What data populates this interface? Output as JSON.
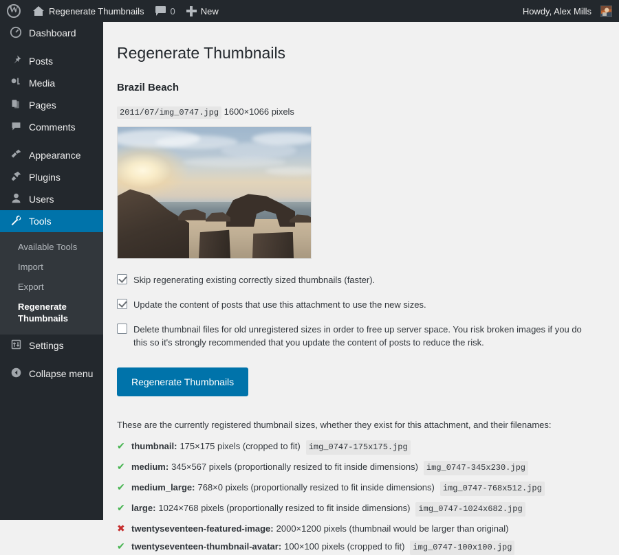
{
  "adminbar": {
    "wp_logo": "wordpress-logo",
    "site_name": "Regenerate Thumbnails",
    "comments_count": "0",
    "new_label": "New",
    "howdy": "Howdy, Alex Mills"
  },
  "sidebar": {
    "items": [
      {
        "label": "Dashboard",
        "icon": "dashboard-icon",
        "current": false
      },
      {
        "label": "Posts",
        "icon": "pin-icon",
        "current": false
      },
      {
        "label": "Media",
        "icon": "media-icon",
        "current": false
      },
      {
        "label": "Pages",
        "icon": "pages-icon",
        "current": false
      },
      {
        "label": "Comments",
        "icon": "comments-icon",
        "current": false
      },
      {
        "label": "Appearance",
        "icon": "paintbrush-icon",
        "current": false
      },
      {
        "label": "Plugins",
        "icon": "plugins-icon",
        "current": false
      },
      {
        "label": "Users",
        "icon": "users-icon",
        "current": false
      },
      {
        "label": "Tools",
        "icon": "wrench-icon",
        "current": true
      },
      {
        "label": "Settings",
        "icon": "settings-sliders-icon",
        "current": false
      },
      {
        "label": "Collapse menu",
        "icon": "collapse-arrow-icon",
        "current": false
      }
    ],
    "submenu": [
      {
        "label": "Available Tools",
        "current": false
      },
      {
        "label": "Import",
        "current": false
      },
      {
        "label": "Export",
        "current": false
      },
      {
        "label": "Regenerate Thumbnails",
        "current": true
      }
    ]
  },
  "main": {
    "page_title": "Regenerate Thumbnails",
    "attachment_title": "Brazil Beach",
    "file_path": "2011/07/img_0747.jpg",
    "dimensions": "1600×1066 pixels",
    "thumbnail_alt": "Brazil Beach sunset with rock formations",
    "options": [
      {
        "label": "Skip regenerating existing correctly sized thumbnails (faster).",
        "checked": true
      },
      {
        "label": "Update the content of posts that use this attachment to use the new sizes.",
        "checked": true
      },
      {
        "label": "Delete thumbnail files for old unregistered sizes in order to free up server space. You risk broken images if you do this so it's strongly recommended that you update the content of posts to reduce the risk.",
        "checked": false
      }
    ],
    "submit_label": "Regenerate Thumbnails",
    "sizes_intro": "These are the currently registered thumbnail sizes, whether they exist for this attachment, and their filenames:",
    "sizes": [
      {
        "status": "yes",
        "icon": "green-check-icon",
        "glyph": "✔",
        "name": "thumbnail:",
        "detail": "175×175 pixels (cropped to fit)",
        "file": "img_0747-175x175.jpg"
      },
      {
        "status": "yes",
        "icon": "green-check-icon",
        "glyph": "✔",
        "name": "medium:",
        "detail": "345×567 pixels (proportionally resized to fit inside dimensions)",
        "file": "img_0747-345x230.jpg"
      },
      {
        "status": "yes",
        "icon": "green-check-icon",
        "glyph": "✔",
        "name": "medium_large:",
        "detail": "768×0 pixels (proportionally resized to fit inside dimensions)",
        "file": "img_0747-768x512.jpg"
      },
      {
        "status": "yes",
        "icon": "green-check-icon",
        "glyph": "✔",
        "name": "large:",
        "detail": "1024×768 pixels (proportionally resized to fit inside dimensions)",
        "file": "img_0747-1024x682.jpg"
      },
      {
        "status": "no",
        "icon": "red-x-icon",
        "glyph": "✖",
        "name": "twentyseventeen-featured-image:",
        "detail": "2000×1200 pixels (thumbnail would be larger than original)",
        "file": ""
      },
      {
        "status": "yes",
        "icon": "green-check-icon",
        "glyph": "✔",
        "name": "twentyseventeen-thumbnail-avatar:",
        "detail": "100×100 pixels (cropped to fit)",
        "file": "img_0747-100x100.jpg"
      }
    ]
  },
  "colors": {
    "accent": "#0073aa",
    "adminbar_bg": "#23282d",
    "submenu_bg": "#32373c",
    "content_bg": "#f1f1f1",
    "success": "#46b450",
    "error": "#c62d2d"
  }
}
